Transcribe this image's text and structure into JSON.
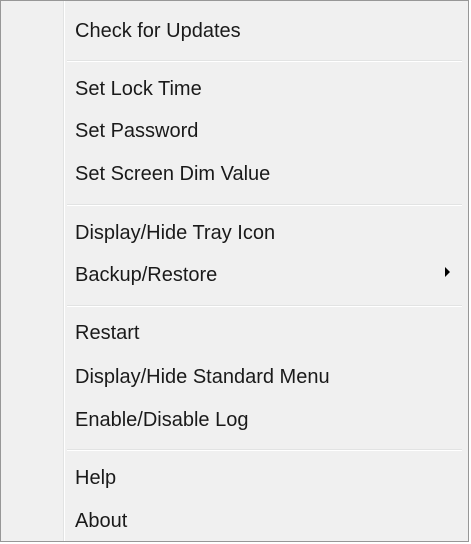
{
  "menu": {
    "items": [
      {
        "label": "Check for Updates"
      },
      {
        "label": "Set Lock Time"
      },
      {
        "label": "Set Password"
      },
      {
        "label": "Set Screen Dim Value"
      },
      {
        "label": "Display/Hide Tray Icon"
      },
      {
        "label": "Backup/Restore",
        "has_submenu": true
      },
      {
        "label": "Restart"
      },
      {
        "label": "Display/Hide Standard Menu"
      },
      {
        "label": "Enable/Disable Log"
      },
      {
        "label": "Help"
      },
      {
        "label": "About"
      }
    ],
    "submenu_icon": "chevron-right-icon"
  }
}
